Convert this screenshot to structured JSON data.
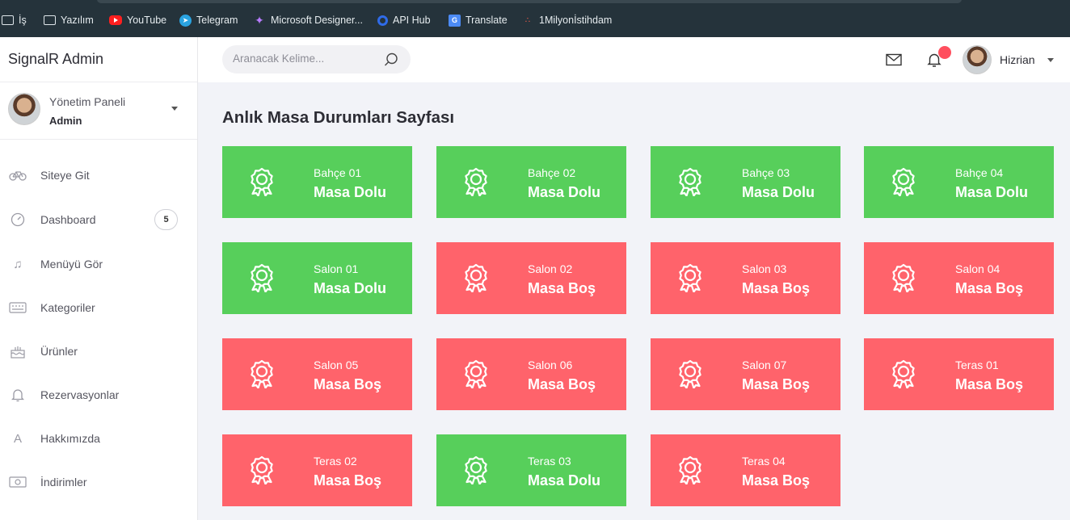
{
  "bookmarks": [
    {
      "label": "İş",
      "icon": "folder-icon"
    },
    {
      "label": "Yazılım",
      "icon": "folder-icon"
    },
    {
      "label": "YouTube",
      "icon": "youtube-icon"
    },
    {
      "label": "Telegram",
      "icon": "telegram-icon"
    },
    {
      "label": "Microsoft Designer...",
      "icon": "designer-icon"
    },
    {
      "label": "API Hub",
      "icon": "api-hub-icon"
    },
    {
      "label": "Translate",
      "icon": "translate-icon"
    },
    {
      "label": "1Milyonİstihdam",
      "icon": "dots-icon"
    }
  ],
  "sidebar": {
    "brand": "SignalR Admin",
    "profile": {
      "title": "Yönetim Paneli",
      "role": "Admin"
    },
    "items": [
      {
        "label": "Siteye Git",
        "icon": "bicycle-icon"
      },
      {
        "label": "Dashboard",
        "icon": "gauge-icon",
        "badge": "5"
      },
      {
        "label": "Menüyü Gör",
        "icon": "music-note-icon"
      },
      {
        "label": "Kategoriler",
        "icon": "keyboard-icon"
      },
      {
        "label": "Ürünler",
        "icon": "cake-icon"
      },
      {
        "label": "Rezervasyonlar",
        "icon": "bell-icon"
      },
      {
        "label": "Hakkımızda",
        "icon": "letter-a-icon"
      },
      {
        "label": "İndirimler",
        "icon": "money-icon"
      }
    ]
  },
  "topbar": {
    "search_placeholder": "Aranacak Kelime...",
    "user_name": "Hizrian"
  },
  "page": {
    "title": "Anlık Masa Durumları Sayfası"
  },
  "colors": {
    "occupied": "#57cf5b",
    "empty": "#ff636b",
    "notification": "#ff4f5e"
  },
  "tables": [
    {
      "name": "Bahçe 01",
      "status": "Masa Dolu",
      "state": "occupied"
    },
    {
      "name": "Bahçe 02",
      "status": "Masa Dolu",
      "state": "occupied"
    },
    {
      "name": "Bahçe 03",
      "status": "Masa Dolu",
      "state": "occupied"
    },
    {
      "name": "Bahçe 04",
      "status": "Masa Dolu",
      "state": "occupied"
    },
    {
      "name": "Salon 01",
      "status": "Masa Dolu",
      "state": "occupied"
    },
    {
      "name": "Salon 02",
      "status": "Masa Boş",
      "state": "empty"
    },
    {
      "name": "Salon 03",
      "status": "Masa Boş",
      "state": "empty"
    },
    {
      "name": "Salon 04",
      "status": "Masa Boş",
      "state": "empty"
    },
    {
      "name": "Salon 05",
      "status": "Masa Boş",
      "state": "empty"
    },
    {
      "name": "Salon 06",
      "status": "Masa Boş",
      "state": "empty"
    },
    {
      "name": "Salon 07",
      "status": "Masa Boş",
      "state": "empty"
    },
    {
      "name": "Teras 01",
      "status": "Masa Boş",
      "state": "empty"
    },
    {
      "name": "Teras 02",
      "status": "Masa Boş",
      "state": "empty"
    },
    {
      "name": "Teras 03",
      "status": "Masa Dolu",
      "state": "occupied"
    },
    {
      "name": "Teras 04",
      "status": "Masa Boş",
      "state": "empty"
    }
  ]
}
